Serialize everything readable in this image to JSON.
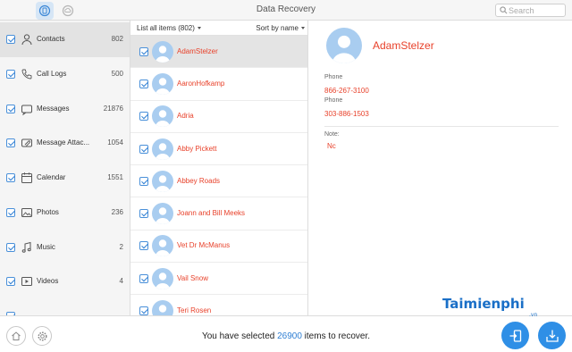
{
  "window": {
    "title": "Data Recovery"
  },
  "search": {
    "placeholder": "Search"
  },
  "sidebar": {
    "items": [
      {
        "label": "Contacts",
        "count": "802",
        "icon": "person-icon",
        "selected": true
      },
      {
        "label": "Call Logs",
        "count": "500",
        "icon": "phone-icon"
      },
      {
        "label": "Messages",
        "count": "21876",
        "icon": "message-icon"
      },
      {
        "label": "Message Attac...",
        "count": "1054",
        "icon": "paperclip-icon"
      },
      {
        "label": "Calendar",
        "count": "1551",
        "icon": "calendar-icon"
      },
      {
        "label": "Photos",
        "count": "236",
        "icon": "photo-icon"
      },
      {
        "label": "Music",
        "count": "2",
        "icon": "music-icon"
      },
      {
        "label": "Videos",
        "count": "4",
        "icon": "video-icon"
      }
    ]
  },
  "list": {
    "header_left": "List all items (802)",
    "header_right": "Sort by name",
    "rows": [
      {
        "name": "AdamStelzer",
        "selected": true
      },
      {
        "name": "AaronHofkamp"
      },
      {
        "name": "Adria"
      },
      {
        "name": "Abby Pickett"
      },
      {
        "name": "Abbey Roads"
      },
      {
        "name": "Joann and Bill Meeks"
      },
      {
        "name": "Vet Dr McManus"
      },
      {
        "name": "Vail Snow"
      },
      {
        "name": "Teri Rosen"
      }
    ]
  },
  "detail": {
    "name": "AdamStelzer",
    "phone_label_1": "Phone",
    "phone_1": "866-267-3100",
    "phone_label_2": "Phone",
    "phone_2": "303-886-1503",
    "note_label": "Note:",
    "note_value": "Nc"
  },
  "footer": {
    "status_prefix": "You have selected ",
    "status_count": "26900",
    "status_suffix": " items to recover."
  },
  "watermark": {
    "text": "Taimienphi",
    "suffix": ".vn"
  },
  "colors": {
    "accent": "#2f8fe6",
    "name_red": "#e8412a"
  }
}
